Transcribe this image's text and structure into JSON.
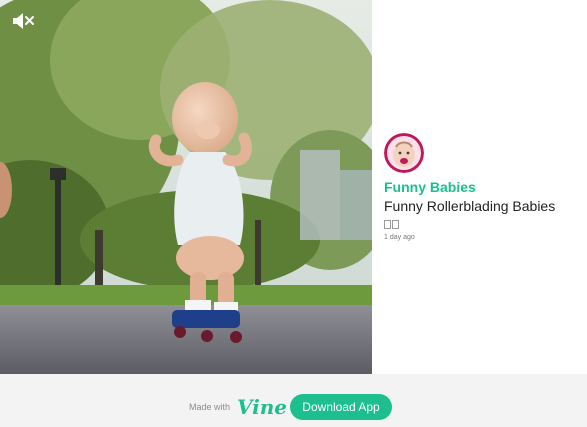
{
  "post": {
    "channel_name": "Funny Babies",
    "title": "Funny Rollerblading Babies",
    "loop_icon": "loops-icon",
    "time_ago": "1 day ago",
    "avatar": "baby-face-avatar"
  },
  "player": {
    "mute_icon": "speaker-muted-icon",
    "muted": true
  },
  "footer": {
    "made_with": "Made with",
    "brand": "Vine",
    "download_label": "Download App"
  },
  "colors": {
    "accent": "#1dbf8e",
    "avatar_ring": "#c2185b",
    "footer_bg": "#f3f3f3"
  }
}
